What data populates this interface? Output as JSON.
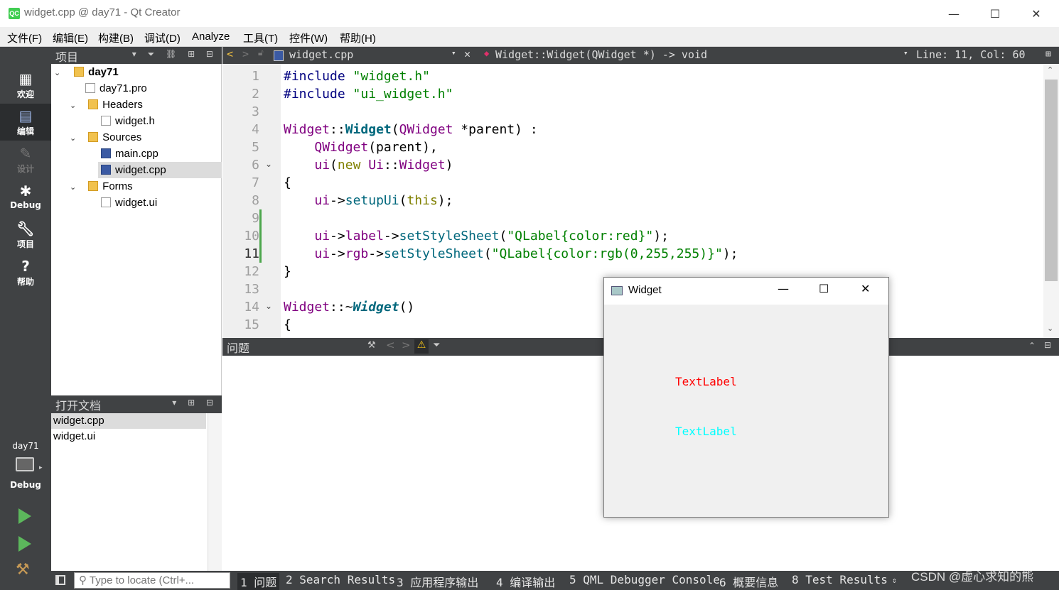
{
  "window": {
    "title": "widget.cpp @ day71 - Qt Creator",
    "app_icon": "QC",
    "minimize": "—",
    "maximize": "☐",
    "close": "✕"
  },
  "menu": [
    "文件(F)",
    "编辑(E)",
    "构建(B)",
    "调试(D)",
    "Analyze",
    "工具(T)",
    "控件(W)",
    "帮助(H)"
  ],
  "modes": {
    "welcome": "欢迎",
    "edit": "编辑",
    "design": "设计",
    "debug": "Debug",
    "projects": "项目",
    "help": "帮助",
    "kit_project": "day71",
    "kit_config": "Debug"
  },
  "projects_pane": {
    "title": "项目",
    "tree": {
      "root": "day71",
      "pro": "day71.pro",
      "headers": "Headers",
      "header_file": "widget.h",
      "sources": "Sources",
      "main": "main.cpp",
      "widget_cpp": "widget.cpp",
      "forms": "Forms",
      "widget_ui": "widget.ui"
    }
  },
  "open_docs": {
    "title": "打开文档",
    "items": [
      "widget.cpp",
      "widget.ui"
    ]
  },
  "editor": {
    "file": "widget.cpp",
    "symbol": "Widget::Widget(QWidget *) -> void",
    "position": "Line: 11, Col: 60",
    "line_numbers": [
      "1",
      "2",
      "3",
      "4",
      "5",
      "6",
      "7",
      "8",
      "9",
      "10",
      "11",
      "12",
      "13",
      "14",
      "15"
    ]
  },
  "issues": {
    "title": "问题"
  },
  "status": {
    "locator_placeholder": "Type to locate (Ctrl+...",
    "tabs": [
      "1 问题",
      "2 Search Results",
      "3 应用程序输出",
      "4 编译输出",
      "5 QML Debugger Console",
      "6 概要信息",
      "8 Test Results"
    ]
  },
  "widget_window": {
    "title": "Widget",
    "label1": "TextLabel",
    "label1_color": "#ff0000",
    "label2": "TextLabel",
    "label2_color": "#00ffff"
  },
  "watermark": "CSDN @虚心求知的熊"
}
